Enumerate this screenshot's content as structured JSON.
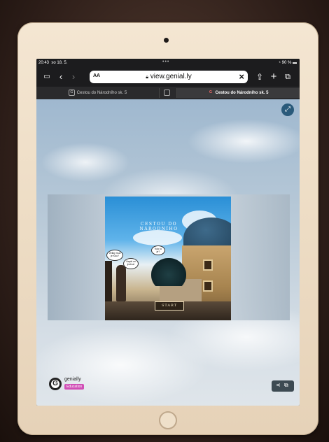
{
  "status": {
    "time": "20:43",
    "date": "so 18. 5.",
    "battery": "90 %"
  },
  "browser": {
    "sidebar_icon": "sidebar-icon",
    "back_icon": "chevron-left-icon",
    "forward_icon": "chevron-right-icon",
    "text_size_label": "AA",
    "url": "view.genial.ly",
    "lock_icon": "lock-icon",
    "clear_icon": "close-icon",
    "share_icon": "share-icon",
    "new_tab_icon": "plus-icon",
    "tabs_icon": "tabs-icon",
    "tabs": [
      {
        "label": "Cestou do Národního sk. 5",
        "active": false
      },
      {
        "label": "",
        "active": false
      },
      {
        "label": "Cestou do Národního sk. 5",
        "active": true
      }
    ]
  },
  "slide": {
    "title": "CESTOU DO NÁRODNÍHO",
    "start_label": "START",
    "bubbles": [
      "Veliký muž je Kdo?",
      "Napiš mi jména!",
      "Kdo to je?"
    ]
  },
  "footer": {
    "brand": "genially",
    "badge": "Education"
  },
  "colors": {
    "accent": "#2a5a7a",
    "badge": "#d04fb6"
  }
}
